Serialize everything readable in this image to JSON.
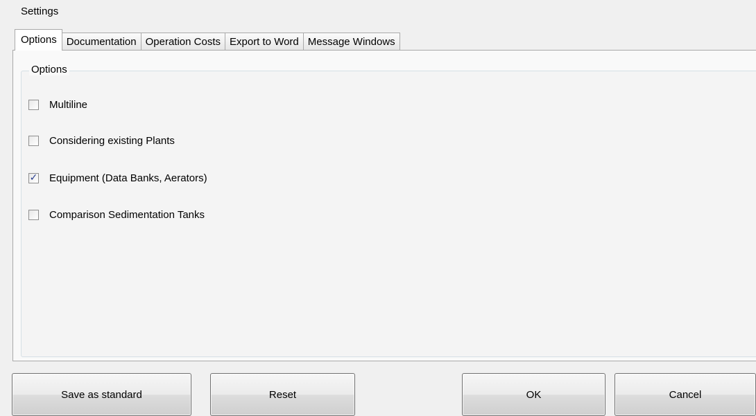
{
  "window": {
    "title": "Settings"
  },
  "tabs": [
    {
      "label": "Options",
      "active": true
    },
    {
      "label": "Documentation",
      "active": false
    },
    {
      "label": "Operation Costs",
      "active": false
    },
    {
      "label": "Export to Word",
      "active": false
    },
    {
      "label": "Message Windows",
      "active": false
    }
  ],
  "options_group": {
    "legend": "Options",
    "items": [
      {
        "label": "Multiline",
        "checked": false
      },
      {
        "label": "Considering existing Plants",
        "checked": false
      },
      {
        "label": "Equipment (Data Banks, Aerators)",
        "checked": true
      },
      {
        "label": "Comparison Sedimentation Tanks",
        "checked": false
      }
    ]
  },
  "buttons": {
    "save_standard": "Save as standard",
    "reset": "Reset",
    "ok": "OK",
    "cancel": "Cancel"
  },
  "check_mark": "✓"
}
